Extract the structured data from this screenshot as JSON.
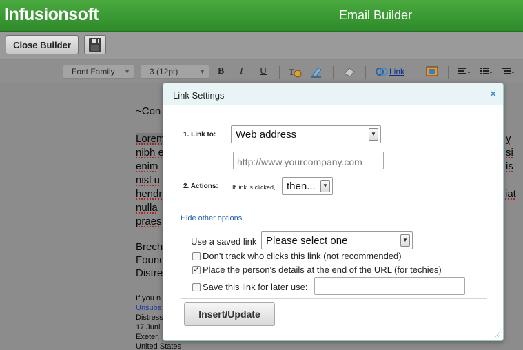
{
  "header": {
    "logo": "Infusionsoft",
    "title": "Email Builder"
  },
  "builderbar": {
    "close_label": "Close Builder"
  },
  "toolbar": {
    "font_family": "Font Family",
    "font_size": "3 (12pt)",
    "bold": "B",
    "italic": "I",
    "underline": "U",
    "link_label": "Link"
  },
  "document": {
    "lines": [
      "~Con",
      "Lorem",
      "nibh e",
      "enim",
      "nisl u",
      "hendr",
      "nulla",
      "praes"
    ],
    "right_fragments": [
      "y",
      "si",
      "is",
      "iat"
    ],
    "signature": [
      "Brech",
      "Found",
      "Distre"
    ],
    "footer": [
      "If you n",
      "Unsubs",
      "Distress",
      "17 Juni",
      "Exeter,",
      "United States"
    ]
  },
  "modal": {
    "title": "Link Settings",
    "close_glyph": "×",
    "link_to_label": "1. Link to:",
    "link_to_value": "Web address",
    "url_placeholder": "http://www.yourcompany.com",
    "actions_label": "2. Actions:",
    "if_clicked_label": "If link is clicked,",
    "then_value": "then...",
    "hide_options": "Hide other options",
    "saved_link_label": "Use a saved link",
    "saved_link_value": "Please select one",
    "dont_track": "Don't track who clicks this link (not recommended)",
    "place_details": "Place the person's details at the end of the URL (for techies)",
    "save_link": "Save this link for later use:",
    "insert_label": "Insert/Update",
    "checkbox_dont_track": false,
    "checkbox_place_details": true,
    "checkbox_save_link": false
  }
}
